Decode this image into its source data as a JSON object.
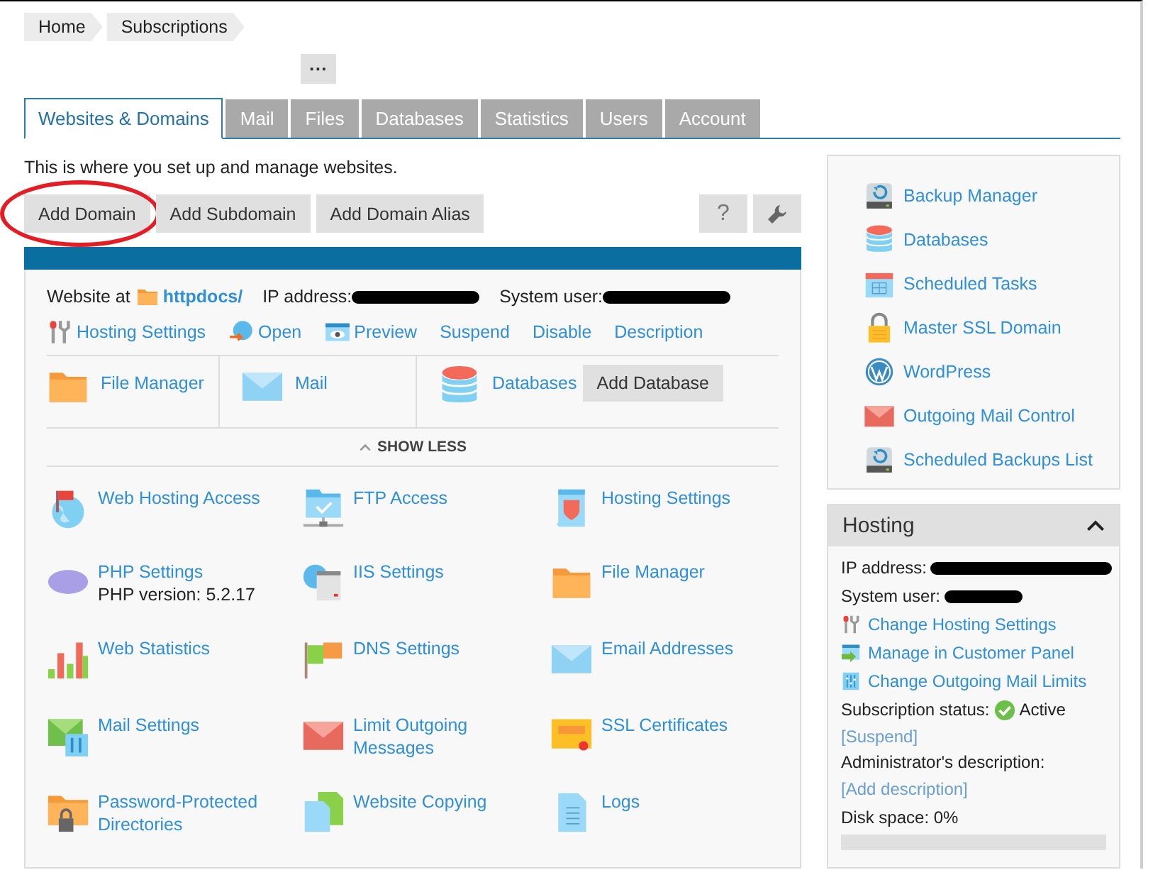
{
  "breadcrumbs": [
    {
      "label": "Home"
    },
    {
      "label": "Subscriptions"
    }
  ],
  "more_button": {
    "label": "···"
  },
  "tabs": [
    {
      "label": "Websites & Domains",
      "selected": true
    },
    {
      "label": "Mail",
      "selected": false
    },
    {
      "label": "Files",
      "selected": false
    },
    {
      "label": "Databases",
      "selected": false
    },
    {
      "label": "Statistics",
      "selected": false
    },
    {
      "label": "Users",
      "selected": false
    },
    {
      "label": "Account",
      "selected": false
    }
  ],
  "intro": "This is where you set up and manage websites.",
  "toolbar": {
    "buttons": [
      {
        "label": "Add Domain",
        "highlighted": true
      },
      {
        "label": "Add Subdomain",
        "highlighted": false
      },
      {
        "label": "Add Domain Alias",
        "highlighted": false
      }
    ],
    "help_button": "?"
  },
  "domain": {
    "info": {
      "website_label": "Website at",
      "website_link": "httpdocs/",
      "ip_label": "IP address:",
      "ip_redacted": true,
      "user_label": "System user:",
      "user_redacted": true
    },
    "actions": [
      {
        "label": "Hosting Settings"
      },
      {
        "label": "Open"
      },
      {
        "label": "Preview"
      },
      {
        "label": "Suspend"
      },
      {
        "label": "Disable"
      },
      {
        "label": "Description"
      }
    ],
    "tools": [
      {
        "label": "File Manager"
      },
      {
        "label": "Mail"
      },
      {
        "label": "Databases",
        "button": "Add Database"
      }
    ],
    "toggle": "SHOW LESS",
    "grid": [
      {
        "label": "Web Hosting Access"
      },
      {
        "label": "FTP Access"
      },
      {
        "label": "Hosting Settings"
      },
      {
        "label": "PHP Settings",
        "note": "PHP version: 5.2.17"
      },
      {
        "label": "IIS Settings"
      },
      {
        "label": "File Manager"
      },
      {
        "label": "Web Statistics"
      },
      {
        "label": "DNS Settings"
      },
      {
        "label": "Email Addresses"
      },
      {
        "label": "Mail Settings"
      },
      {
        "label": "Limit Outgoing Messages"
      },
      {
        "label": "SSL Certificates"
      },
      {
        "label": "Password-Protected Directories"
      },
      {
        "label": "Website Copying"
      },
      {
        "label": "Logs"
      }
    ]
  },
  "side_links": [
    {
      "label": "Backup Manager"
    },
    {
      "label": "Databases"
    },
    {
      "label": "Scheduled Tasks"
    },
    {
      "label": "Master SSL Domain"
    },
    {
      "label": "WordPress"
    },
    {
      "label": "Outgoing Mail Control"
    },
    {
      "label": "Scheduled Backups List"
    }
  ],
  "hosting": {
    "title": "Hosting",
    "expanded": true,
    "ip_label": "IP address:",
    "ip_redacted": true,
    "user_label": "System user:",
    "user_redacted": true,
    "links": [
      {
        "label": "Change Hosting Settings"
      },
      {
        "label": "Manage in Customer Panel"
      },
      {
        "label": "Change Outgoing Mail Limits"
      }
    ],
    "status_label": "Subscription status:",
    "status": "Active",
    "status_ok": true,
    "suspend_link": "[Suspend]",
    "description_label": "Administrator's description:",
    "description_link": "[Add description]",
    "disk_label": "Disk space: 0%",
    "disk": {
      "level": 0
    }
  }
}
